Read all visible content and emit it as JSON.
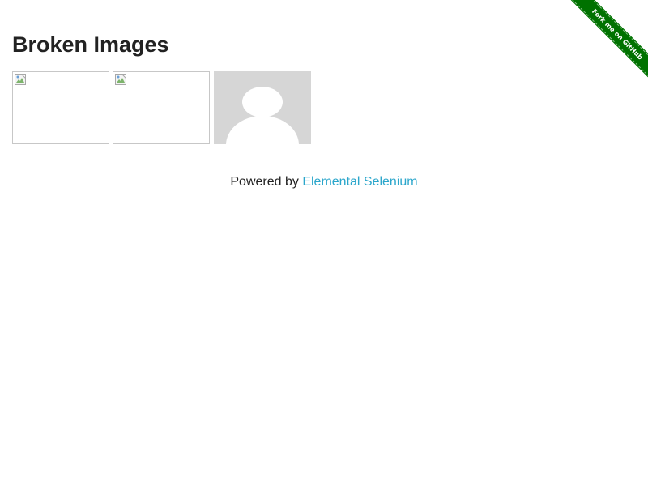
{
  "ribbon": {
    "label": "Fork me on GitHub",
    "color": "#007200"
  },
  "page": {
    "title": "Broken Images",
    "images": [
      {
        "state": "broken",
        "icon": "broken-image-icon"
      },
      {
        "state": "broken",
        "icon": "broken-image-icon"
      },
      {
        "state": "loaded",
        "icon": "avatar-placeholder"
      }
    ]
  },
  "footer": {
    "prefix": "Powered by ",
    "link_label": "Elemental Selenium",
    "link_color": "#2ba6cb"
  }
}
